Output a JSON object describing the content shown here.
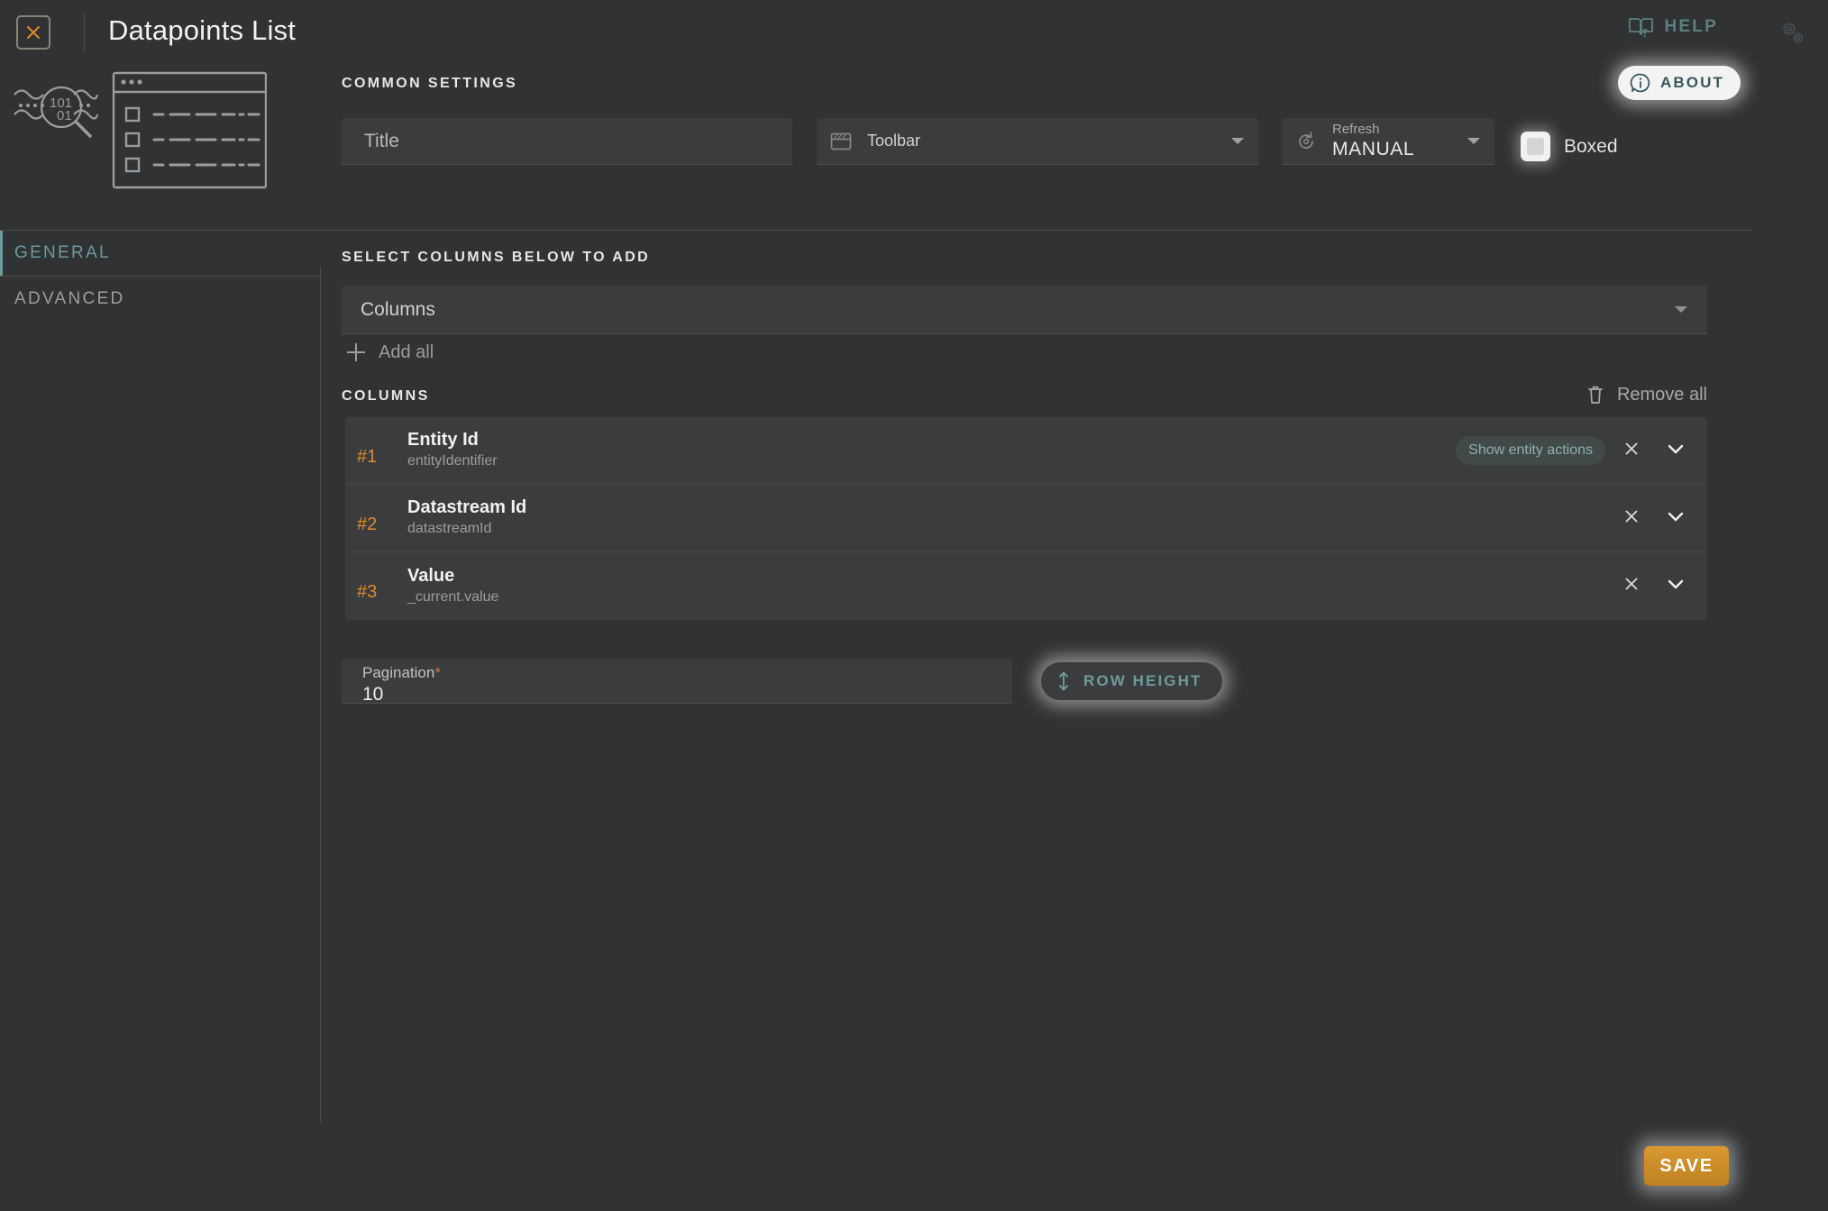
{
  "header": {
    "title": "Datapoints List",
    "close_icon": "close-x-icon",
    "help_label": "HELP",
    "help_icon": "book-question-icon",
    "gear_icon": "gears-icon",
    "about_label": "ABOUT",
    "about_icon": "info-bubble-icon"
  },
  "thumbnail": {
    "icon": "datapoints-magnifier-icon",
    "preview": "list-window-preview"
  },
  "common_settings": {
    "section_label": "COMMON SETTINGS",
    "title_field": {
      "placeholder": "Title",
      "value": ""
    },
    "toolbar_field": {
      "label": "Toolbar",
      "icon": "toolbar-window-icon",
      "value": ""
    },
    "refresh_field": {
      "label": "Refresh",
      "value": "MANUAL",
      "icon": "refresh-icon"
    },
    "boxed": {
      "label": "Boxed",
      "checked": false
    }
  },
  "sidebar": {
    "tabs": [
      {
        "label": "GENERAL",
        "active": true
      },
      {
        "label": "ADVANCED",
        "active": false
      }
    ]
  },
  "main": {
    "select_label": "SELECT COLUMNS BELOW TO ADD",
    "columns_select": {
      "placeholder": "Columns",
      "value": ""
    },
    "add_all_label": "Add all",
    "add_all_icon": "plus-icon",
    "columns_label": "COLUMNS",
    "remove_all_label": "Remove all",
    "remove_all_icon": "trash-icon",
    "columns": [
      {
        "index": "#1",
        "name": "Entity Id",
        "key": "entityIdentifier",
        "chip": "Show entity actions",
        "remove_icon": "close-x-icon",
        "expand_icon": "chevron-down-icon"
      },
      {
        "index": "#2",
        "name": "Datastream Id",
        "key": "datastreamId",
        "chip": "",
        "remove_icon": "close-x-icon",
        "expand_icon": "chevron-down-icon"
      },
      {
        "index": "#3",
        "name": "Value",
        "key": "_current.value",
        "chip": "",
        "remove_icon": "close-x-icon",
        "expand_icon": "chevron-down-icon"
      }
    ],
    "pagination": {
      "label": "Pagination",
      "required_mark": "*",
      "value": "10"
    },
    "row_height": {
      "label": "ROW HEIGHT",
      "icon": "height-arrows-icon"
    }
  },
  "footer": {
    "save_label": "SAVE"
  },
  "colors": {
    "background": "#303234",
    "field": "#3a3c3e",
    "accent_teal": "#6d9b9c",
    "accent_orange": "#e08a2b",
    "save_orange": "#d9992f",
    "text_primary": "#f1f1f1",
    "text_muted": "#9a9c9e"
  }
}
